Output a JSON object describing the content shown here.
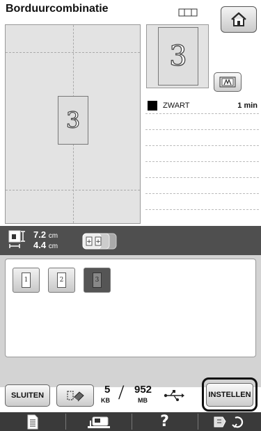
{
  "header": {
    "title": "Borduurcombinatie",
    "frame_icon": "embroidery-frame-icon",
    "home_icon": "home-icon"
  },
  "canvas": {
    "pattern_char": "3"
  },
  "preview": {
    "pattern_char": "3",
    "image_button_icon": "image-display-icon"
  },
  "colors": [
    {
      "name": "ZWART",
      "time": "1 min",
      "hex": "#000000"
    },
    {
      "name": "",
      "time": ""
    },
    {
      "name": "",
      "time": ""
    },
    {
      "name": "",
      "time": ""
    },
    {
      "name": "",
      "time": ""
    },
    {
      "name": "",
      "time": ""
    },
    {
      "name": "",
      "time": ""
    }
  ],
  "info": {
    "width_value": "7.2",
    "width_unit": "cm",
    "height_value": "4.4",
    "height_unit": "cm",
    "size_icon": "pattern-size-icon",
    "multi_select_icon": "multi-select-icon"
  },
  "patterns": [
    {
      "char": "1",
      "selected": false
    },
    {
      "char": "2",
      "selected": false
    },
    {
      "char": "3",
      "selected": true
    }
  ],
  "footer": {
    "close_label": "SLUITEN",
    "delete_icon": "eraser-icon",
    "memory_kb": "5",
    "memory_kb_unit": "KB",
    "memory_slash": "/",
    "memory_mb": "952",
    "memory_mb_unit": "MB",
    "usb_icon": "usb-icon",
    "set_label": "INSTELLEN"
  },
  "tabs": [
    {
      "icon": "document-icon",
      "label": ""
    },
    {
      "icon": "machine-icon",
      "label": ""
    },
    {
      "icon": "help-icon",
      "label": "?"
    },
    {
      "icon": "settings-icon",
      "label": ""
    }
  ],
  "colors_theme": {
    "background": "#ffffff",
    "dark_bar": "#4f4f4f",
    "tab_bar": "#3a3a3a",
    "panel_gray": "#d3d3d3"
  }
}
